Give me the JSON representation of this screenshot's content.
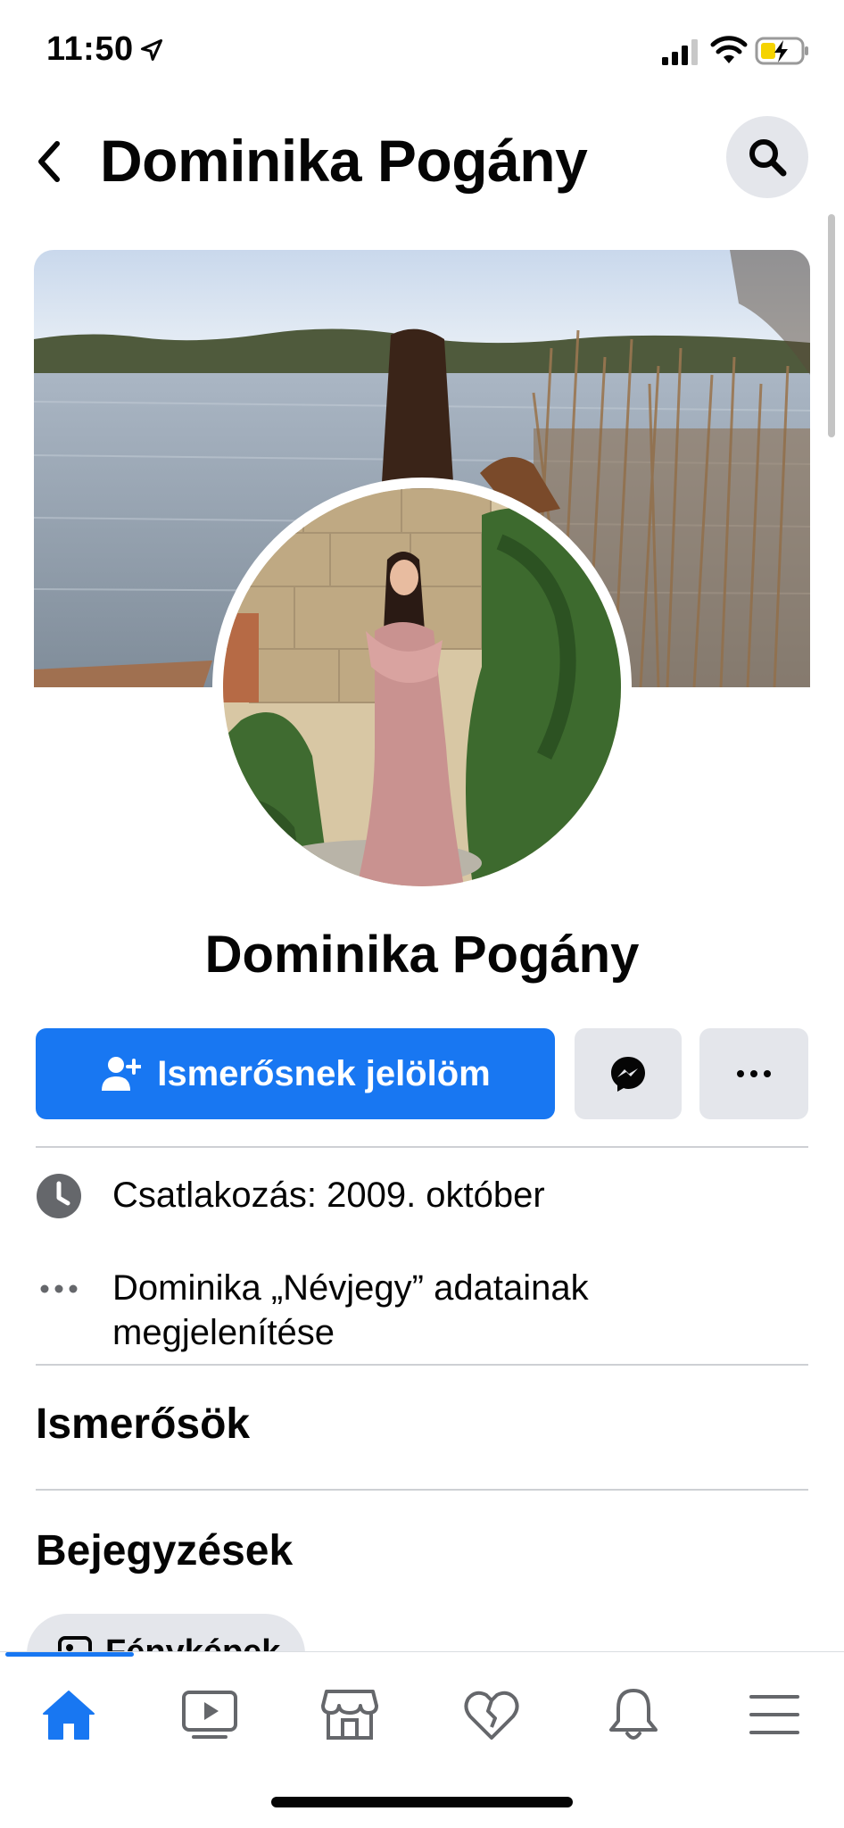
{
  "status_bar": {
    "time": "11:50",
    "icons": [
      "location-arrow-icon",
      "cellular-signal-icon",
      "wifi-icon",
      "battery-charging-icon"
    ]
  },
  "header": {
    "title": "Dominika Pogány",
    "back_icon": "chevron-left-icon",
    "search_icon": "search-icon"
  },
  "profile": {
    "name": "Dominika Pogány"
  },
  "actions": {
    "add_friend_label": "Ismerősnek jelölöm",
    "add_friend_icon": "add-person-icon",
    "message_icon": "messenger-icon",
    "more_icon": "more-dots-icon"
  },
  "info": {
    "joined": "Csatlakozás: 2009. október",
    "about_line1": "Dominika „Névjegy” adatainak",
    "about_line2": "megjelenítése"
  },
  "sections": {
    "friends": "Ismerősök",
    "posts": "Bejegyzések"
  },
  "chip": {
    "label": "Fényképek"
  },
  "bottom_nav": {
    "items": [
      "home-icon",
      "video-icon",
      "marketplace-icon",
      "dating-heart-icon",
      "notifications-bell-icon",
      "menu-icon"
    ],
    "active": "home-icon"
  },
  "colors": {
    "brand_blue": "#1877f2",
    "button_gray": "#e4e6eb",
    "divider": "#ced0d4"
  }
}
